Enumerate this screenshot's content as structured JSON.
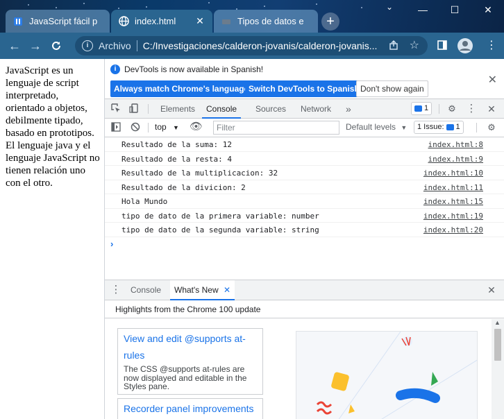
{
  "browser": {
    "tabs": [
      {
        "title": "JavaScript fácil p",
        "active": false
      },
      {
        "title": "index.html",
        "active": true
      },
      {
        "title": "Tipos de datos e",
        "active": false
      }
    ],
    "address": {
      "scheme_label": "Archivo",
      "url": "C:/Investigaciones/calderon-jovanis/calderon-jovanis..."
    }
  },
  "page": {
    "text": "JavaScript es un lenguaje de script interpretado, orientado a objetos, debilmente tipado, basado en prototipos. El lenguaje java y el lenguaje JavaScript no tienen relación uno con el otro."
  },
  "devtools": {
    "infobar": {
      "message": "DevTools is now available in Spanish!",
      "btn_always": "Always match Chrome's language",
      "btn_switch": "Switch DevTools to Spanish",
      "btn_dont_show": "Don't show again"
    },
    "tabs": {
      "elements": "Elements",
      "console": "Console",
      "sources": "Sources",
      "network": "Network",
      "more": "»",
      "badge_count": "1"
    },
    "console_toolbar": {
      "context": "top",
      "filter_placeholder": "Filter",
      "levels": "Default levels",
      "issues": "1 Issue:",
      "issues_count": "1"
    },
    "log": [
      {
        "text": "Resultado de la suma: 12",
        "source": "index.html:8"
      },
      {
        "text": "Resultado de la resta: 4",
        "source": "index.html:9"
      },
      {
        "text": "Resultado de la multiplicacion: 32",
        "source": "index.html:10"
      },
      {
        "text": "Resultado de la divicion: 2",
        "source": "index.html:11"
      },
      {
        "text": "Hola Mundo",
        "source": "index.html:15"
      },
      {
        "text": "tipo de dato de la primera variable: number",
        "source": "index.html:19"
      },
      {
        "text": "tipo de dato de la segunda variable: string",
        "source": "index.html:20"
      }
    ],
    "drawer": {
      "tab_console": "Console",
      "tab_whats_new": "What's New",
      "highlights": "Highlights from the Chrome 100 update",
      "card1_title": "View and edit @supports at-rules",
      "card1_desc": "The CSS @supports at-rules are now displayed and editable in the Styles pane.",
      "card2_title": "Recorder panel improvements"
    }
  }
}
